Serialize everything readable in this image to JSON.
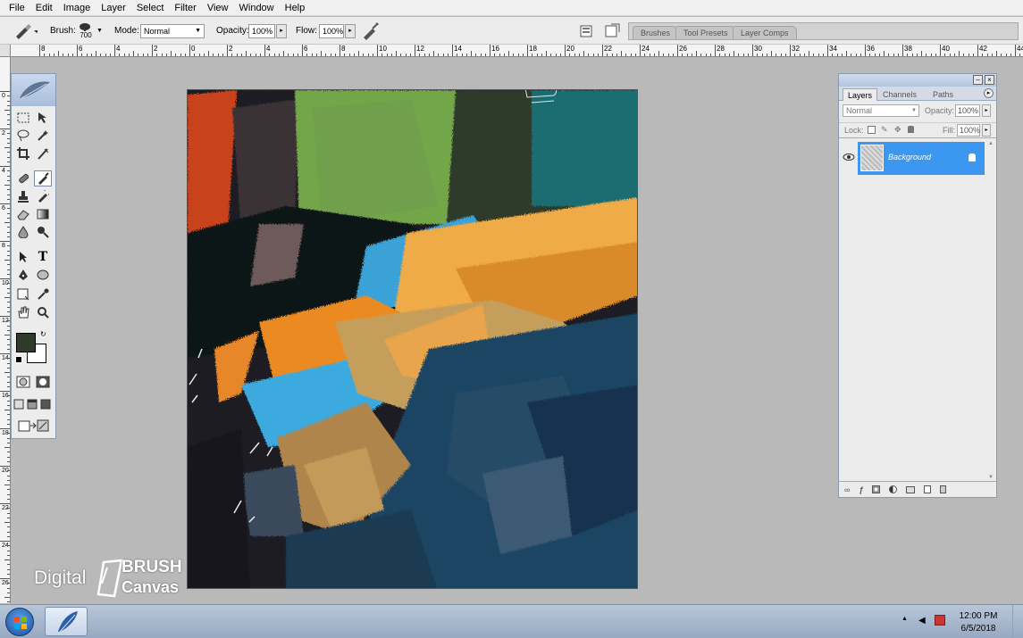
{
  "menu": [
    "File",
    "Edit",
    "Image",
    "Layer",
    "Select",
    "Filter",
    "View",
    "Window",
    "Help"
  ],
  "options": {
    "brush_label": "Brush:",
    "brush_size": "700",
    "mode_label": "Mode:",
    "mode_value": "Normal",
    "opacity_label": "Opacity:",
    "opacity_value": "100%",
    "flow_label": "Flow:",
    "flow_value": "100%"
  },
  "palette_well": [
    "Brushes",
    "Tool Presets",
    "Layer Comps"
  ],
  "ruler_h": [
    "8",
    "6",
    "4",
    "2",
    "0",
    "2",
    "4",
    "6",
    "8",
    "10",
    "12",
    "14",
    "16",
    "18",
    "20",
    "22",
    "24",
    "26",
    "28",
    "30",
    "32",
    "34",
    "36",
    "38",
    "40",
    "42",
    "44"
  ],
  "ruler_v": [
    "0",
    "2",
    "4",
    "6",
    "8",
    "10",
    "12",
    "14",
    "16",
    "18",
    "20",
    "22",
    "24",
    "26"
  ],
  "colors": {
    "foreground": "#2e3b2a",
    "background": "#ffffff",
    "layer_selected": "#3b97ef",
    "canvas_base": "#1a1b1e"
  },
  "layers_panel": {
    "tabs": [
      "Layers",
      "Channels",
      "Paths"
    ],
    "blend_mode": "Normal",
    "opacity_label": "Opacity:",
    "opacity_value": "100%",
    "lock_label": "Lock:",
    "fill_label": "Fill:",
    "fill_value": "100%",
    "layer_name": "Background"
  },
  "watermark": {
    "line1": "Digital",
    "line2": "BRUSH",
    "line3": "Canvas"
  },
  "taskbar": {
    "time": "12:00 PM",
    "date": "6/5/2018"
  }
}
